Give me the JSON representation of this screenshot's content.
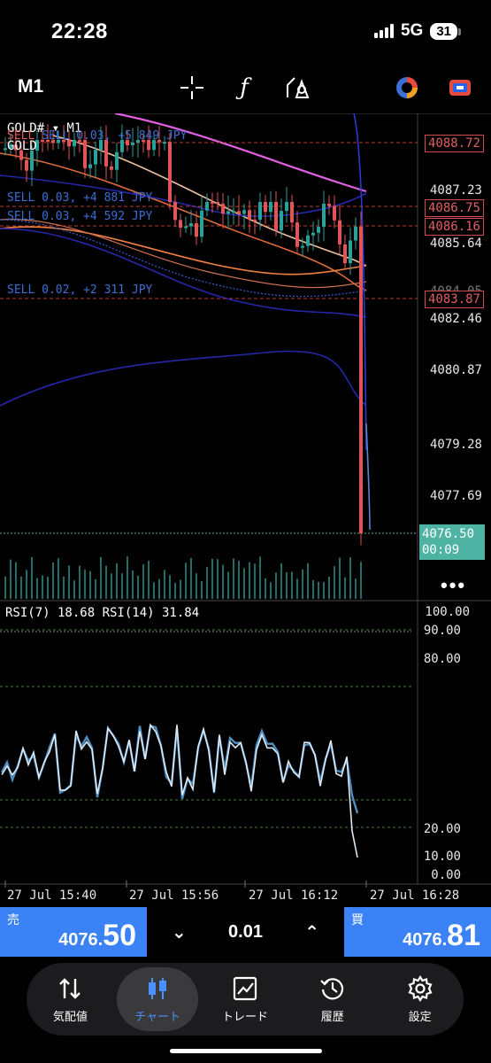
{
  "status": {
    "time": "22:28",
    "network": "5G",
    "battery": "31"
  },
  "toolbar": {
    "timeframe": "M1"
  },
  "chart": {
    "symbol_line": "GOLD# ▾ M1",
    "symbol": "GOLD",
    "orders": [
      {
        "text": "SELL 0.03, +5 849 JPY"
      },
      {
        "text": "SELL 0.03, +4 881 JPY"
      },
      {
        "text": "SELL 0.03, +4 592 JPY"
      },
      {
        "text": "SELL 0.02, +2 311 JPY"
      }
    ],
    "price_labels": [
      "4087.23",
      "4085.64",
      "4084.05",
      "4082.46",
      "4080.87",
      "4079.28",
      "4077.69"
    ],
    "order_levels": [
      "4088.72",
      "4086.75",
      "4086.16",
      "4083.87"
    ],
    "current_price": "4076.50",
    "countdown": "00:09",
    "colors": {
      "bull": "#2aa198",
      "bear": "#e05555",
      "current": "#4fb3a3"
    }
  },
  "rsi": {
    "title": "RSI(7) 18.68 RSI(14) 31.84",
    "levels": [
      "100.00",
      "90.00",
      "80.00",
      "20.00",
      "10.00",
      "0.00"
    ]
  },
  "time_axis": [
    "27 Jul 15:40",
    "27 Jul 15:56",
    "27 Jul 16:12",
    "27 Jul 16:28"
  ],
  "trade": {
    "sell_label": "売",
    "sell_price_small": "4076.",
    "sell_price_large": "50",
    "lot": "0.01",
    "buy_label": "買",
    "buy_price_small": "4076.",
    "buy_price_large": "81"
  },
  "nav": [
    {
      "label": "気配値",
      "icon": "quotes-icon"
    },
    {
      "label": "チャート",
      "icon": "candlestick-icon"
    },
    {
      "label": "トレード",
      "icon": "trade-chart-icon"
    },
    {
      "label": "履歴",
      "icon": "history-icon"
    },
    {
      "label": "設定",
      "icon": "gear-icon"
    }
  ]
}
